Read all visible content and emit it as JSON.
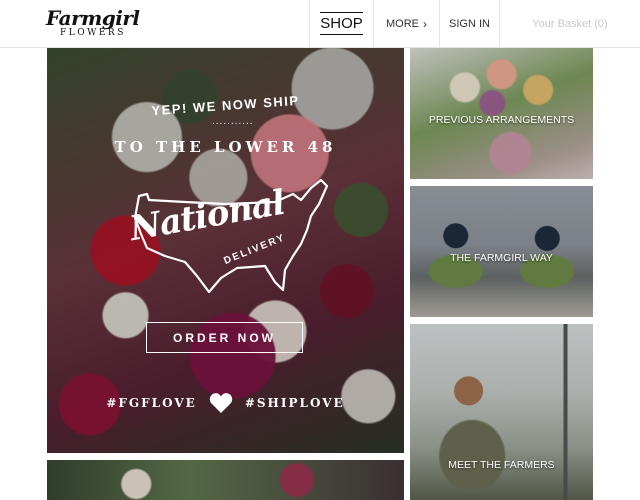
{
  "header": {
    "logo": {
      "brand": "Farmgirl",
      "sub": "FLOWERS"
    },
    "nav": {
      "shop": "SHOP",
      "more": "MORE",
      "sign_in": "SIGN IN",
      "basket": "Your Basket (0)"
    }
  },
  "hero": {
    "yep": "YEP! WE NOW SHIP",
    "dots": "...........",
    "lower48": "TO THE LOWER 48",
    "national": "National",
    "delivery": "DELIVERY",
    "order_button": "ORDER NOW",
    "hashtag_left": "#FGFLOVE",
    "hashtag_right": "#SHIPLOVE"
  },
  "tiles": {
    "previous_arrangements": "PREVIOUS ARRANGEMENTS",
    "farmgirl_way": "THE FARMGIRL WAY",
    "meet_farmers": "MEET THE FARMERS"
  },
  "colors": {
    "text_dark": "#111111",
    "basket_gray": "#c8c8c8",
    "border": "#e6e6e6",
    "overlay_text": "#ffffff"
  },
  "icons": {
    "more_chevron": "chevron-right-icon",
    "heart": "heart-icon",
    "map": "us-map-outline-icon"
  }
}
